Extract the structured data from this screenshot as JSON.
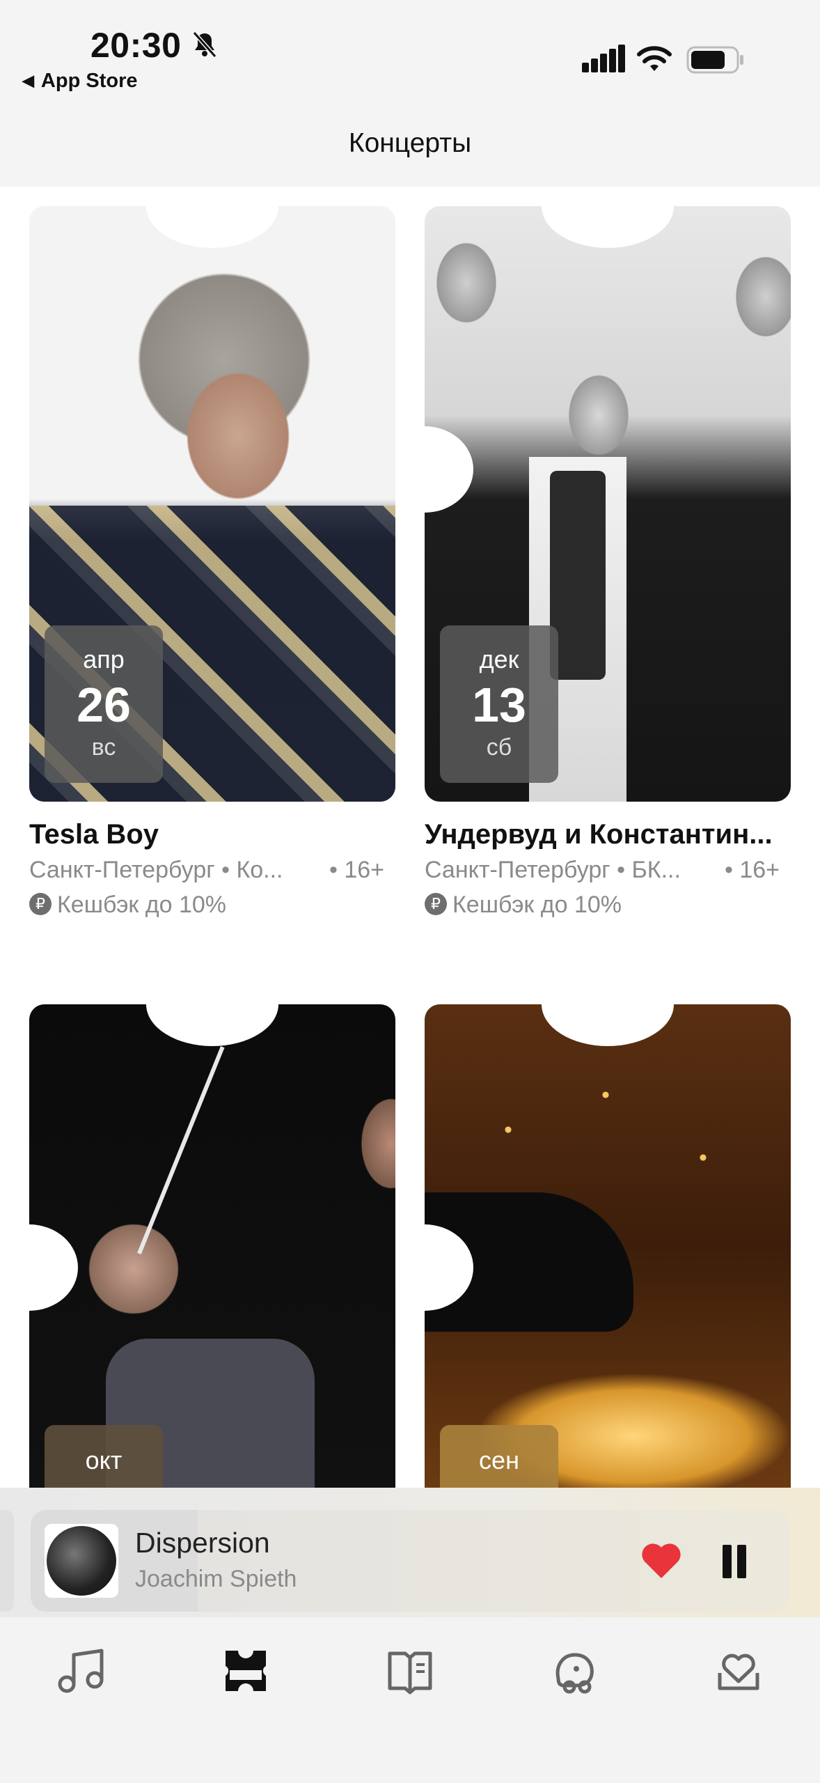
{
  "status_bar": {
    "time": "20:30",
    "back_label": "App Store"
  },
  "header": {
    "title": "Концерты"
  },
  "events": [
    {
      "month": "апр",
      "day": "26",
      "weekday": "вс",
      "title": "Tesla Boy",
      "location": "Санкт-Петербург • Ко...",
      "age": "• 16+",
      "cashback": "Кешбэк до 10%"
    },
    {
      "month": "дек",
      "day": "13",
      "weekday": "сб",
      "title": "Ундервуд и Константин...",
      "location": "Санкт-Петербург • БК...",
      "age": "• 16+",
      "cashback": "Кешбэк до 10%"
    },
    {
      "month": "окт"
    },
    {
      "month": "сен"
    }
  ],
  "player": {
    "title": "Dispersion",
    "artist": "Joachim Spieth"
  },
  "tabs": [
    "music-icon",
    "tickets-icon",
    "books-icon",
    "kids-icon",
    "favorites-icon"
  ],
  "colors": {
    "like": "#e8343a",
    "text_muted": "#8a8a8a"
  }
}
